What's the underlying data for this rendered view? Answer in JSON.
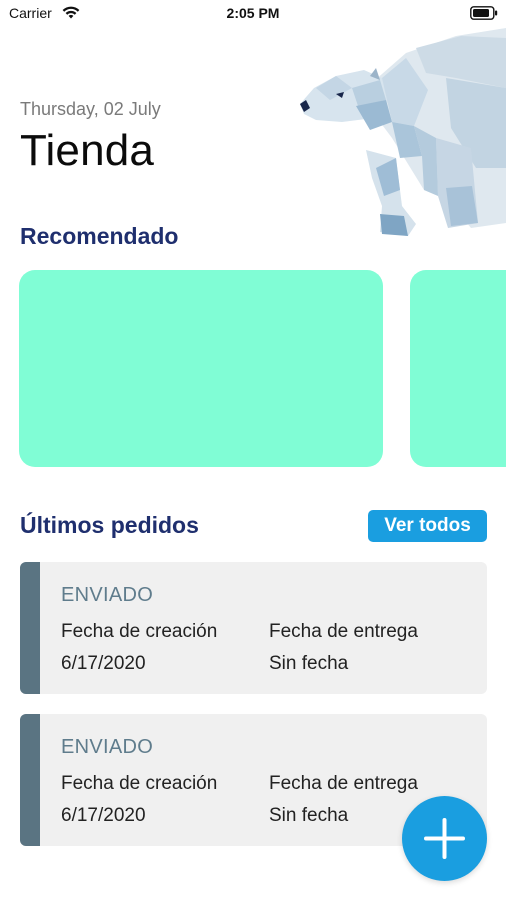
{
  "status_bar": {
    "carrier": "Carrier",
    "time": "2:05 PM",
    "wifi_icon": "wifi-icon",
    "battery_icon": "battery-icon"
  },
  "header": {
    "date": "Thursday, 02 July",
    "title": "Tienda"
  },
  "recommended": {
    "title": "Recomendado",
    "card_color": "#80fdd5"
  },
  "orders": {
    "title": "Últimos pedidos",
    "see_all_label": "Ver todos",
    "items": [
      {
        "status": "ENVIADO",
        "created_label": "Fecha de creación",
        "created_value": "6/17/2020",
        "delivery_label": "Fecha de entrega",
        "delivery_value": "Sin fecha"
      },
      {
        "status": "ENVIADO",
        "created_label": "Fecha de creación",
        "created_value": "6/17/2020",
        "delivery_label": "Fecha de entrega",
        "delivery_value": "Sin fecha"
      }
    ]
  },
  "fab": {
    "icon": "plus-icon"
  },
  "colors": {
    "accent": "#1a9ee0",
    "section_title": "#1f2f6e",
    "order_bar": "#5a7482",
    "card_background": "#f0f0f0"
  }
}
